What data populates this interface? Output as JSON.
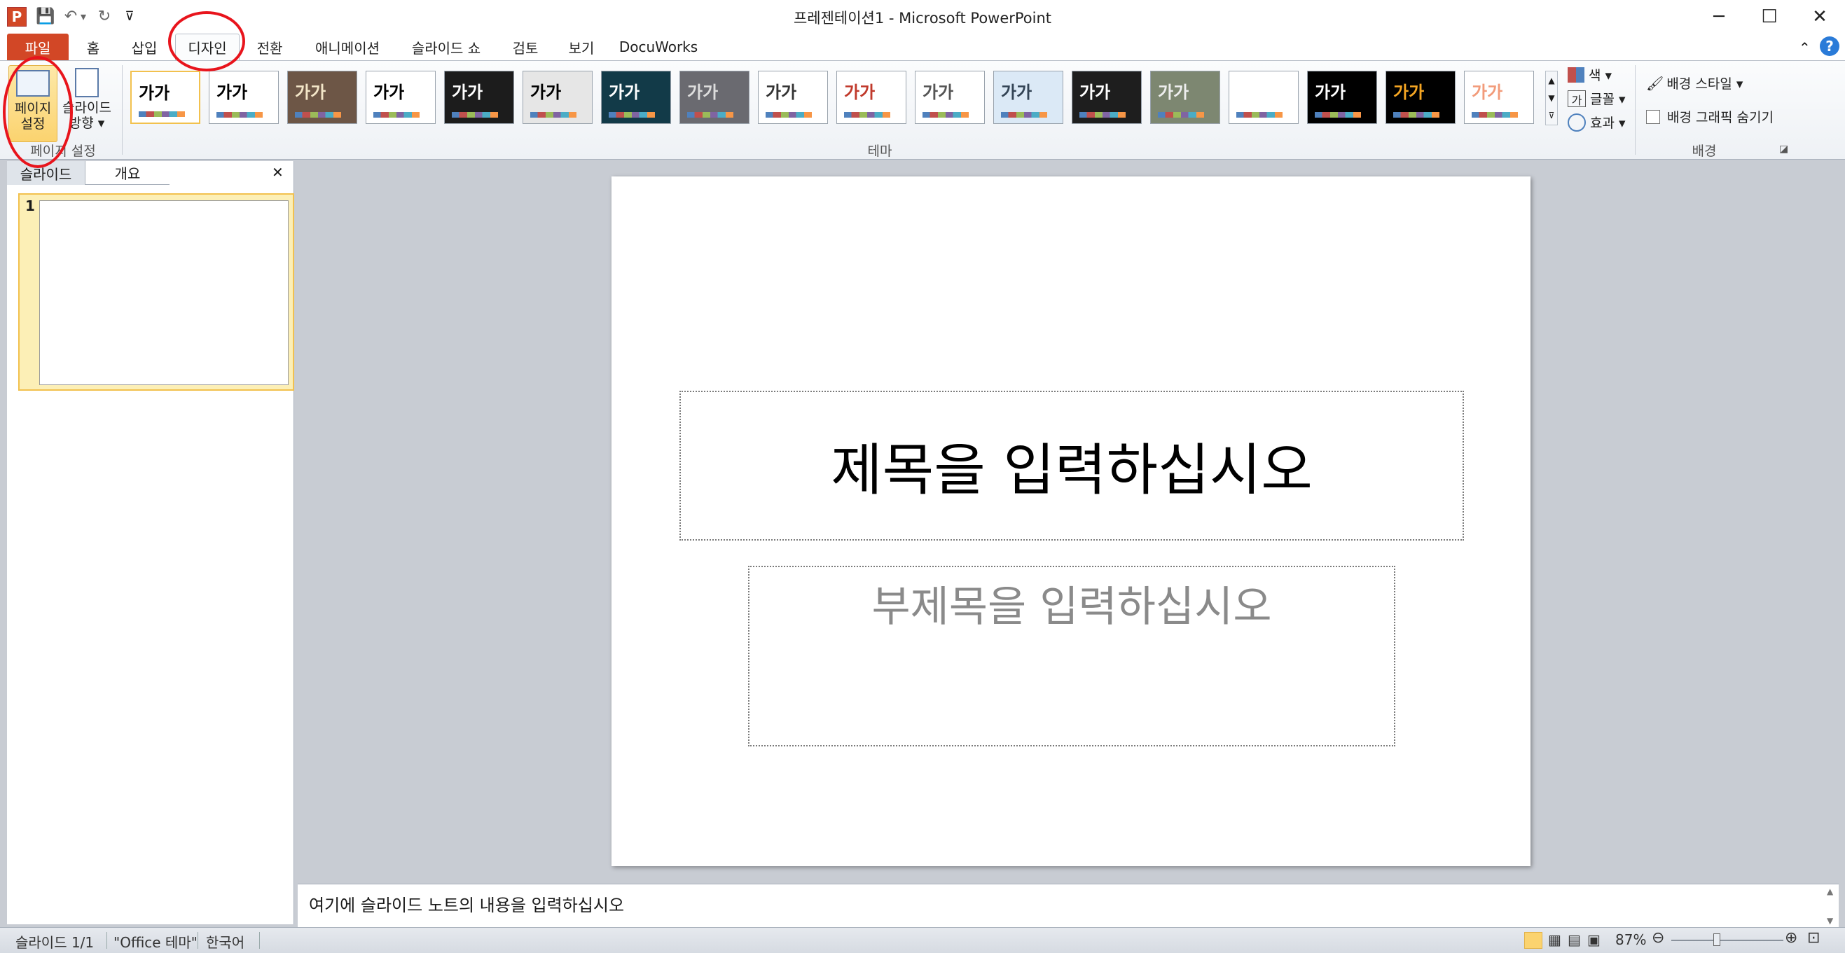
{
  "window": {
    "title": "프레젠테이션1 - Microsoft PowerPoint",
    "minimize": "─",
    "maximize": "☐",
    "close": "✕"
  },
  "qat": {
    "app_logo": "P",
    "save": "💾",
    "undo": "↶",
    "undo_drop": "▾",
    "redo": "↻",
    "customize": "⊽"
  },
  "tabs": [
    {
      "label": "파일"
    },
    {
      "label": "홈"
    },
    {
      "label": "삽입"
    },
    {
      "label": "디자인"
    },
    {
      "label": "전환"
    },
    {
      "label": "애니메이션"
    },
    {
      "label": "슬라이드 쇼"
    },
    {
      "label": "검토"
    },
    {
      "label": "보기"
    },
    {
      "label": "DocuWorks"
    }
  ],
  "ribbon_right": {
    "minimize_ribbon": "⌃",
    "help": "?"
  },
  "page_setup": {
    "page_setup_btn": "페이지\n설정",
    "orientation_btn": "슬라이드\n방향 ▾",
    "group_label": "페이지 설정"
  },
  "themes": {
    "group_label": "테마",
    "sample_text": "가가",
    "colors_btn": "색 ▾",
    "fonts_btn": "글꼴 ▾",
    "effects_btn": "효과 ▾",
    "palette": [
      "#ffffff",
      "#ffffff",
      "#6d5646",
      "#ffffff",
      "#1c1c1c",
      "#e6e6e6",
      "#123a48",
      "#6a6a70",
      "#ffffff",
      "#ffffff",
      "#ffffff",
      "#dbe9f6",
      "#1e1e1e",
      "#7d8771",
      "#ffffff",
      "#000000",
      "#000000",
      "#ffffff"
    ],
    "text_colors": [
      "#000",
      "#000",
      "#f3e6c8",
      "#000",
      "#fff",
      "#000",
      "#fff",
      "#ddd",
      "#333",
      "#c0392b",
      "#555",
      "#345",
      "#fff",
      "#eee",
      "#fff",
      "#fff",
      "#f5a623",
      "#f29b7a"
    ]
  },
  "background": {
    "styles_btn": "배경 스타일 ▾",
    "hide_graphics": "배경 그래픽 숨기기",
    "group_label": "배경"
  },
  "left_panel": {
    "tab_slides": "슬라이드",
    "tab_outline": "개요",
    "close": "✕",
    "slide_number": "1"
  },
  "slide": {
    "title_placeholder": "제목을 입력하십시오",
    "subtitle_placeholder": "부제목을 입력하십시오"
  },
  "notes": {
    "placeholder": "여기에 슬라이드 노트의 내용을 입력하십시오"
  },
  "status": {
    "slide_pos": "슬라이드 1/1",
    "theme": "\"Office 테마\"",
    "language": "한국어",
    "zoom": "87%"
  },
  "colors": {
    "file_tab": "#d24726",
    "annotation": "#e8141c",
    "selection": "#f2c14e"
  }
}
